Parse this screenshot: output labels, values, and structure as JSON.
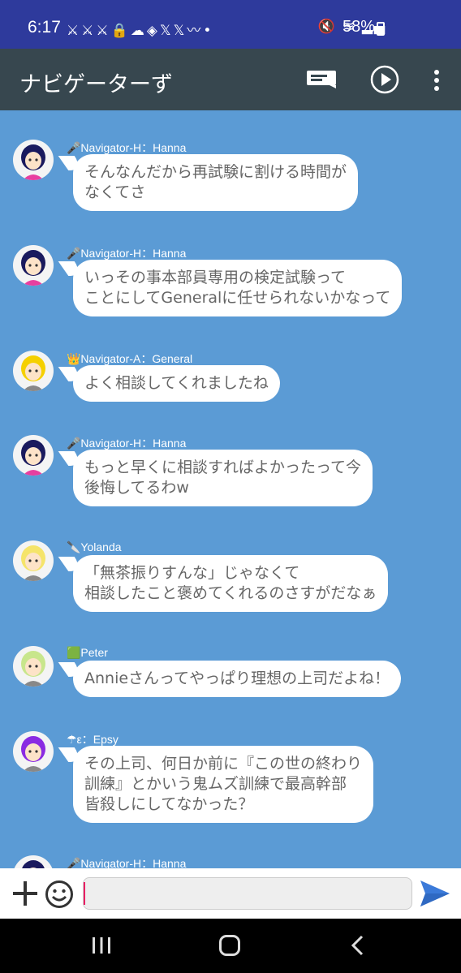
{
  "status": {
    "time": "6:17",
    "left_icons": "⚔⚔⚔🔒☁◈𝕏𝕏〰•",
    "right_icons": "🔇 ≋ ▂▄",
    "battery": "58%"
  },
  "app": {
    "title": "ナビゲーターず",
    "icons": [
      "chat-icon",
      "play-icon",
      "more-icon"
    ]
  },
  "messages": [
    {
      "sender": "🎤Navigator-H：Hanna",
      "text": "そんなんだから再試験に割ける時間が\nなくてさ",
      "avatar": "hanna",
      "avatar_color": "#1a1a5e"
    },
    {
      "sender": "🎤Navigator-H：Hanna",
      "text": "いっその事本部員専用の検定試験って\nことにしてGeneralに任せられないかなって",
      "avatar": "hanna",
      "avatar_color": "#1a1a5e"
    },
    {
      "sender": "👑Navigator-A：General",
      "text": "よく相談してくれましたね",
      "avatar": "general",
      "avatar_color": "#f5d000"
    },
    {
      "sender": "🎤Navigator-H：Hanna",
      "text": "もっと早くに相談すればよかったって今\n後悔してるわw",
      "avatar": "hanna",
      "avatar_color": "#1a1a5e"
    },
    {
      "sender": "🔪Yolanda",
      "text": "「無茶振りすんな」じゃなくて\n相談したこと褒めてくれるのさすがだなぁ",
      "avatar": "yolanda",
      "avatar_color": "#f5e46a"
    },
    {
      "sender": "🟩Peter",
      "text": "Annieさんってやっぱり理想の上司だよね！",
      "avatar": "peter",
      "avatar_color": "#c8e68c"
    },
    {
      "sender": "☂ε：Epsy",
      "text": "その上司、何日か前に『この世の終わり\n訓練』とかいう鬼ムズ訓練で最高幹部\n皆殺しにしてなかった？",
      "avatar": "epsy",
      "avatar_color": "#8a2be2"
    },
    {
      "sender": "🎤Navigator-H：Hanna",
      "text": "",
      "avatar": "hanna",
      "avatar_color": "#1a1a5e"
    }
  ],
  "input": {
    "placeholder": "",
    "value": ""
  },
  "colors": {
    "chat_bg": "#5b9bd5",
    "appbar": "#37474f",
    "statusbar": "#2e3a9c",
    "send": "#3b7ad9"
  }
}
